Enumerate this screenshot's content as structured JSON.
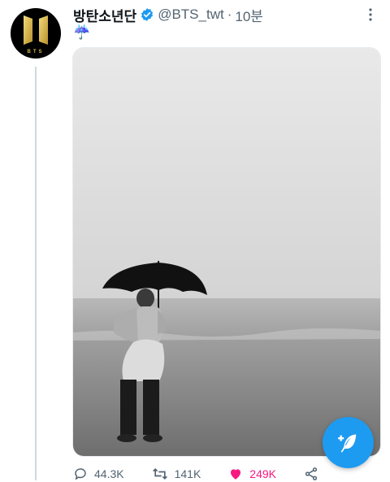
{
  "author": {
    "display_name": "방탄소년단",
    "handle": "@BTS_twt",
    "separator": "·",
    "time_ago": "10분",
    "avatar_text": "BTS"
  },
  "tweet": {
    "text": "☔"
  },
  "actions": {
    "replies": "44.3K",
    "retweets": "141K",
    "likes": "249K"
  },
  "colors": {
    "accent": "#1d9bf0",
    "like": "#f91880",
    "muted": "#536471"
  }
}
